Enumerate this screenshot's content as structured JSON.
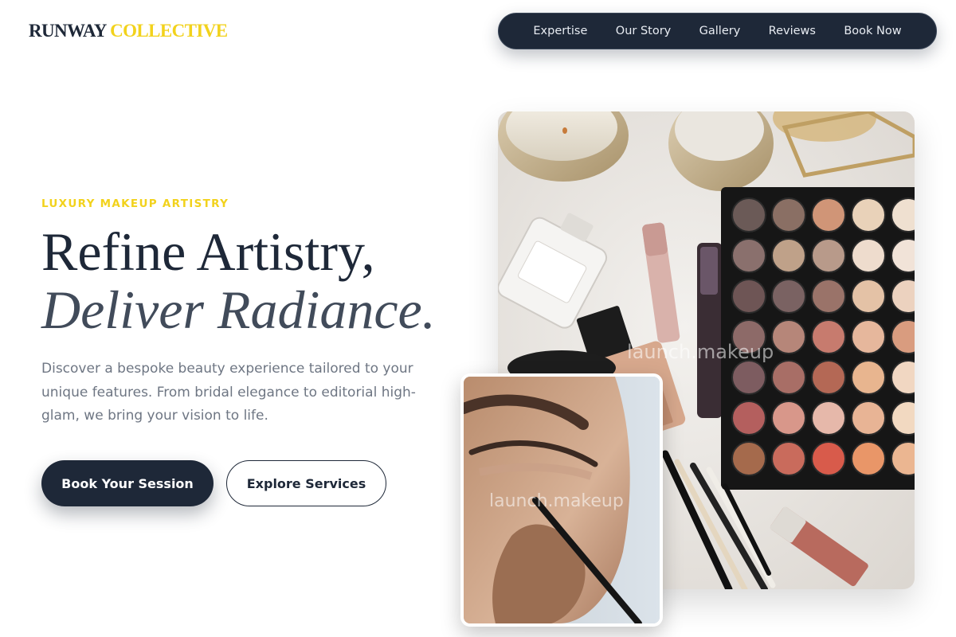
{
  "brand": {
    "word1": "RUNWAY",
    "word2": "COLLECTIVE"
  },
  "nav": {
    "items": [
      "Expertise",
      "Our Story",
      "Gallery",
      "Reviews",
      "Book Now"
    ]
  },
  "hero": {
    "eyebrow": "LUXURY MAKEUP ARTISTRY",
    "headline_line1": "Refine Artistry,",
    "headline_line2": "Deliver Radiance.",
    "description": "Discover a bespoke beauty experience tailored to your unique features. From bridal elegance to editorial high-glam, we bring your vision to life.",
    "primary_button": "Book Your Session",
    "secondary_button": "Explore Services"
  },
  "images": {
    "main_watermark": "launch.makeup",
    "inset_watermark": "launch.makeup"
  },
  "colors": {
    "navy": "#1e2838",
    "accent_yellow": "#f2d21c",
    "text_muted": "#6e7683"
  }
}
